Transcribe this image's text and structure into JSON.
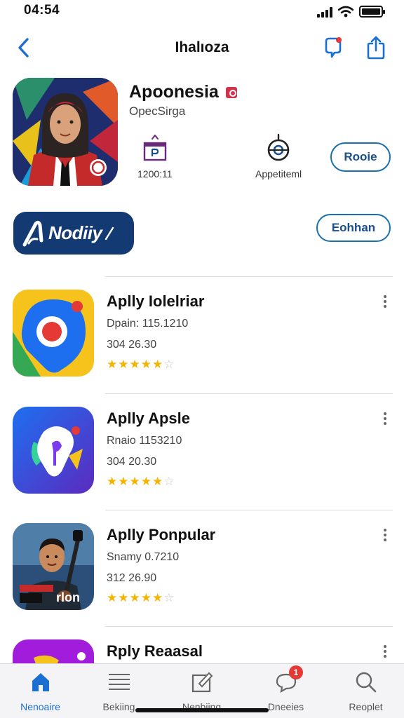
{
  "status": {
    "time": "04:54"
  },
  "nav": {
    "title": "Ihalıoza"
  },
  "app": {
    "name": "Apoonesia",
    "developer": "OpecSirga",
    "stat_value": "1200:11",
    "stat_label": "Appetiteml",
    "action_label": "Rooie"
  },
  "banner": {
    "text": "Nodiiy"
  },
  "secondary_action": {
    "label": "Eohhan"
  },
  "apps": [
    {
      "title": "Aplly Iolelriar",
      "subtitle": "Dpain: 115.1210",
      "meta": "304 26.30",
      "rating": 4.5,
      "icon": "maps-pin-icon"
    },
    {
      "title": "Aplly Apsle",
      "subtitle": "Rnaio 1153210",
      "meta": "304 20.30",
      "rating": 4.5,
      "icon": "drop-pin-icon"
    },
    {
      "title": "Aplly Ponpular",
      "subtitle": "Snamy 0.7210",
      "meta": "312 26.90",
      "rating": 4.5,
      "icon": "guitar-player-icon"
    },
    {
      "title": "Rply Reaasal",
      "subtitle": "",
      "meta": "",
      "rating": null,
      "icon": "partial-app-icon"
    }
  ],
  "tabs": [
    {
      "label": "Nenoaire",
      "icon": "home-icon",
      "active": true
    },
    {
      "label": "Bekiing",
      "icon": "list-icon",
      "active": false
    },
    {
      "label": "Nenbiing",
      "icon": "edit-box-icon",
      "active": false
    },
    {
      "label": "Dneeies",
      "icon": "chat-icon",
      "active": false,
      "badge": "1"
    },
    {
      "label": "Reoplet",
      "icon": "search-icon",
      "active": false
    }
  ],
  "colors": {
    "accent": "#1a6fd0",
    "pill_border": "#1a6fb0",
    "banner_bg": "#133a72",
    "star": "#f4b400",
    "badge_red": "#d2334a"
  }
}
